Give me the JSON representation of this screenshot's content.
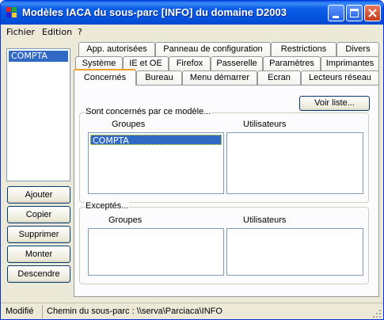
{
  "window": {
    "title": "Modèles IACA du sous-parc [INFO] du domaine D2003"
  },
  "menu": {
    "file": "Fichier",
    "edition": "Edition",
    "help": "?"
  },
  "tree": {
    "selected": "COMPTA"
  },
  "actions": {
    "add": "Ajouter",
    "copy": "Copier",
    "delete": "Supprimer",
    "up": "Monter",
    "down": "Descendre"
  },
  "tabs": {
    "row1": [
      "App. autorisées",
      "Panneau de configuration",
      "Restrictions",
      "Divers"
    ],
    "row2": [
      "Système",
      "IE et OE",
      "Firefox",
      "Passerelle",
      "Paramètres",
      "Imprimantes"
    ],
    "row3": [
      "Concernés",
      "Bureau",
      "Menu démarrer",
      "Ecran",
      "Lecteurs réseau"
    ],
    "active": "Concernés"
  },
  "panel": {
    "view_list_button": "Voir liste...",
    "concerned": {
      "label": "Sont concernés par ce modèle...",
      "groups_header": "Groupes",
      "users_header": "Utilisateurs",
      "groups": [
        "COMPTA"
      ]
    },
    "excepted": {
      "label": "Exceptés...",
      "groups_header": "Groupes",
      "users_header": "Utilisateurs"
    }
  },
  "status": {
    "state": "Modifié",
    "path": "Chemin du sous-parc : \\\\serva\\Parciaca\\INFO"
  }
}
